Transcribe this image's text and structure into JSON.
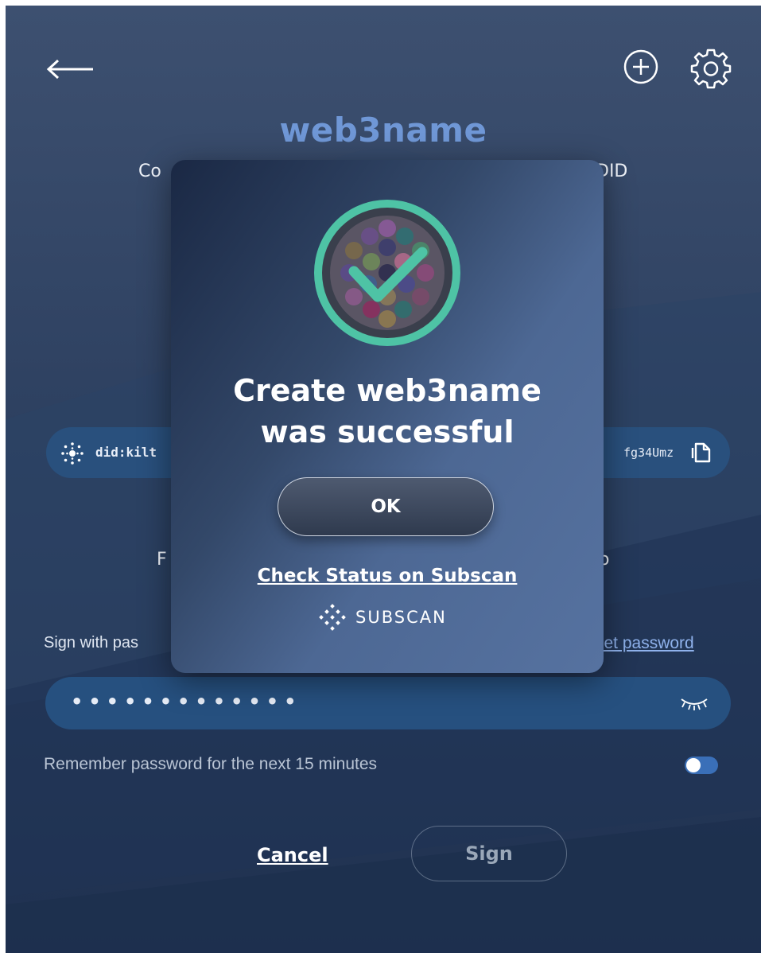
{
  "header": {
    "back_icon": "arrow-left-icon",
    "add_icon": "plus-circle-icon",
    "settings_icon": "gear-icon"
  },
  "title": "web3name",
  "subtitle_left_fragment": "Co",
  "subtitle_right_fragment": "DID",
  "did": {
    "left_fragment": "did:kilt",
    "right_fragment": "fg34Umz",
    "copy_icon": "copy-icon",
    "kilt_icon": "kilt-logo-icon"
  },
  "fragment_left": "F",
  "fragment_right": "o",
  "password": {
    "label_fragment": "Sign with pas",
    "reset_link_fragment": "set password",
    "masked_value": "•••••••••••••",
    "visibility_icon": "eye-closed-icon"
  },
  "remember": {
    "label": "Remember password for the next 15 minutes",
    "enabled": true
  },
  "actions": {
    "cancel_label": "Cancel",
    "sign_label": "Sign"
  },
  "modal": {
    "icon": "success-check-icon",
    "title_line1": "Create web3name",
    "title_line2": "was successful",
    "ok_label": "OK",
    "subscan_link": "Check Status on Subscan",
    "subscan_brand": "SUBSCAN"
  },
  "colors": {
    "background_top": "#3d5070",
    "background_bottom": "#1f3150",
    "accent_title": "#6f97d6",
    "field_fill": "#26507f",
    "success_ring": "#4ec3a5",
    "link": "#8fb2ec"
  }
}
